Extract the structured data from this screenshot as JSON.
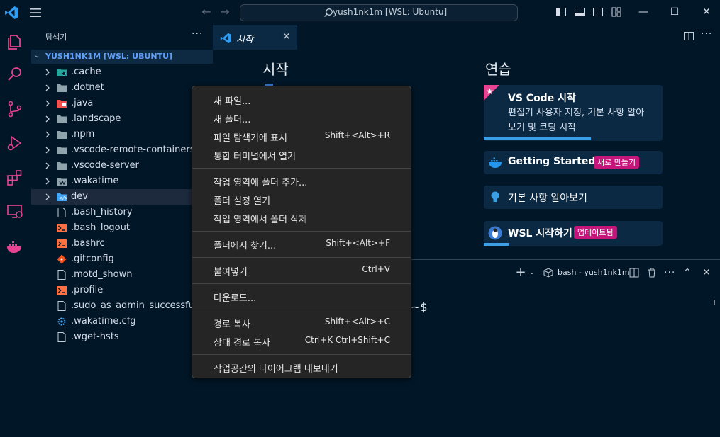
{
  "titlebar": {
    "search_text": "yush1nk1m [WSL: Ubuntu]"
  },
  "sidebar": {
    "title": "탐색기",
    "root_label": "YUSH1NK1M [WSL: UBUNTU]",
    "items": [
      {
        "label": ".cache",
        "type": "folder",
        "icon": "cache-folder-icon"
      },
      {
        "label": ".dotnet",
        "type": "folder",
        "icon": "folder-icon"
      },
      {
        "label": ".java",
        "type": "folder",
        "icon": "java-folder-icon"
      },
      {
        "label": ".landscape",
        "type": "folder",
        "icon": "folder-icon"
      },
      {
        "label": ".npm",
        "type": "folder",
        "icon": "folder-icon"
      },
      {
        "label": ".vscode-remote-containers",
        "type": "folder",
        "icon": "folder-icon"
      },
      {
        "label": ".vscode-server",
        "type": "folder",
        "icon": "folder-icon"
      },
      {
        "label": ".wakatime",
        "type": "folder",
        "icon": "wakatime-folder-icon"
      },
      {
        "label": "dev",
        "type": "folder",
        "icon": "code-folder-icon"
      },
      {
        "label": ".bash_history",
        "type": "file",
        "icon": "file-icon"
      },
      {
        "label": ".bash_logout",
        "type": "file",
        "icon": "terminal-file-icon"
      },
      {
        "label": ".bashrc",
        "type": "file",
        "icon": "terminal-file-icon"
      },
      {
        "label": ".gitconfig",
        "type": "file",
        "icon": "git-file-icon"
      },
      {
        "label": ".motd_shown",
        "type": "file",
        "icon": "file-icon"
      },
      {
        "label": ".profile",
        "type": "file",
        "icon": "terminal-file-icon"
      },
      {
        "label": ".sudo_as_admin_successful",
        "type": "file",
        "icon": "file-icon"
      },
      {
        "label": ".wakatime.cfg",
        "type": "file",
        "icon": "gear-file-icon"
      },
      {
        "label": ".wget-hsts",
        "type": "file",
        "icon": "file-icon"
      }
    ]
  },
  "tab": {
    "label": "시작"
  },
  "welcome": {
    "start_heading": "시작",
    "practice_heading": "연습",
    "cards": [
      {
        "title": "VS Code 시작",
        "desc_line1": "편집기 사용자 지정, 기본 사항 알아",
        "desc_line2": "보기 및 코딩 시작",
        "progress": 0.6
      },
      {
        "title": "Getting Started ...",
        "badge": "새로 만들기"
      },
      {
        "title": "기본 사항 알아보기"
      },
      {
        "title": "WSL 시작하기",
        "badge": "업데이트됨",
        "progress": 0.14
      }
    ]
  },
  "terminal": {
    "label": "bash - yush1nk1m",
    "prompt_tail": "~$"
  },
  "context_menu": {
    "groups": [
      [
        {
          "label": "새 파일...",
          "shortcut": ""
        },
        {
          "label": "새 폴더...",
          "shortcut": ""
        },
        {
          "label": "파일 탐색기에 표시",
          "shortcut": "Shift+<Alt>+R"
        },
        {
          "label": "통합 터미널에서 열기",
          "shortcut": ""
        }
      ],
      [
        {
          "label": "작업 영역에 폴더 추가...",
          "shortcut": ""
        },
        {
          "label": "폴더 설정 열기",
          "shortcut": ""
        },
        {
          "label": "작업 영역에서 폴더 삭제",
          "shortcut": ""
        }
      ],
      [
        {
          "label": "폴더에서 찾기...",
          "shortcut": "Shift+<Alt>+F"
        }
      ],
      [
        {
          "label": "붙여넣기",
          "shortcut": "Ctrl+V"
        }
      ],
      [
        {
          "label": "다운로드...",
          "shortcut": ""
        }
      ],
      [
        {
          "label": "경로 복사",
          "shortcut": "Shift+<Alt>+C"
        },
        {
          "label": "상대 경로 복사",
          "shortcut": "Ctrl+K Ctrl+Shift+C"
        }
      ],
      [
        {
          "label": "작업공간의 다이어그램 내보내기",
          "shortcut": ""
        }
      ]
    ]
  }
}
